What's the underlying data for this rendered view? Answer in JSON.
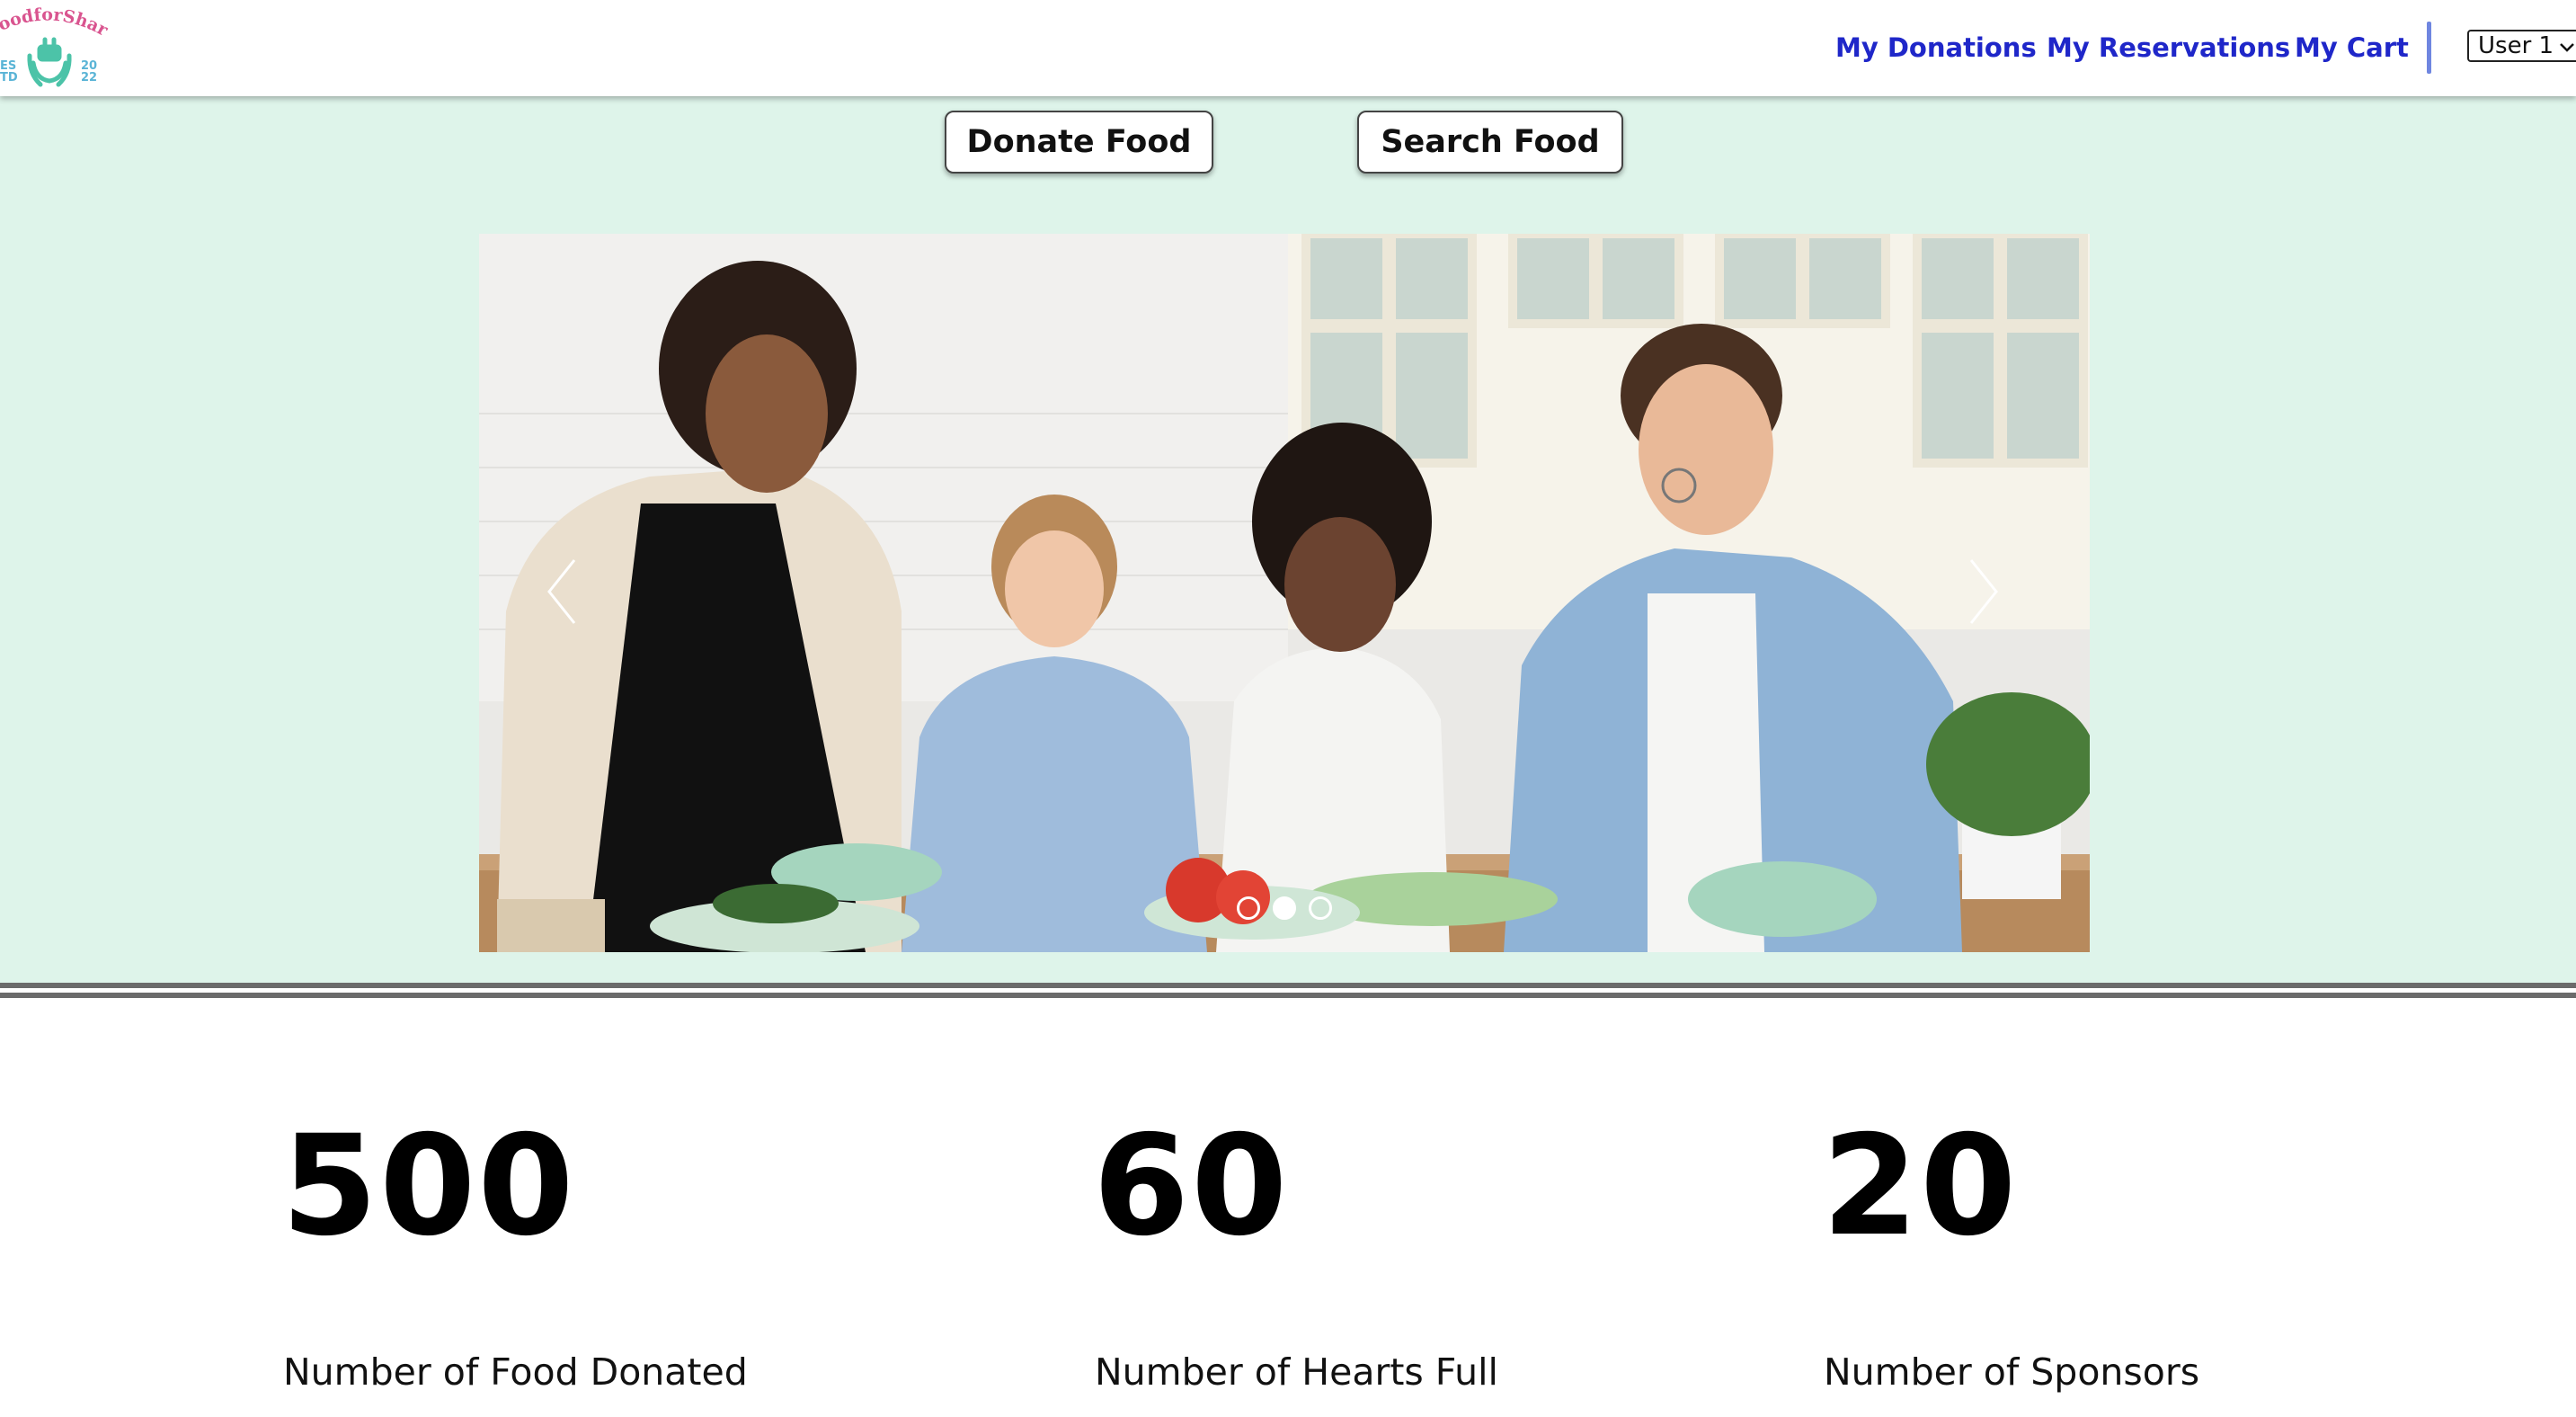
{
  "header": {
    "logo_text": "FoodforShare",
    "logo_est_left_top": "ES",
    "logo_est_left_bottom": "TD",
    "logo_year_top": "20",
    "logo_year_bottom": "22",
    "nav": [
      {
        "label": "My Donations"
      },
      {
        "label": "My Reservations"
      },
      {
        "label": "My Cart"
      }
    ],
    "user_select": {
      "value": "User 1"
    }
  },
  "hero": {
    "buttons": [
      {
        "label": "Donate Food"
      },
      {
        "label": "Search Food"
      }
    ],
    "carousel": {
      "slide_count": 3,
      "active_index": 1
    }
  },
  "stats": [
    {
      "number": "500",
      "label": "Number of Food Donated"
    },
    {
      "number": "60",
      "label": "Number of Hearts Full"
    },
    {
      "number": "20",
      "label": "Number of Sponsors"
    }
  ],
  "colors": {
    "nav_link": "#1f27c9",
    "hero_bg": "#def4ea",
    "divider": "#6f86e0",
    "logo_pink": "#d9548f",
    "logo_teal": "#4cc3a8"
  }
}
